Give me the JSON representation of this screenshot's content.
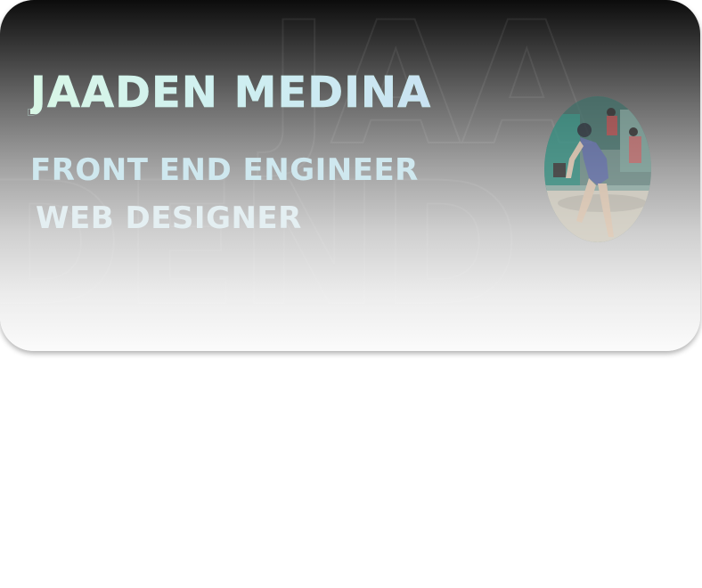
{
  "card": {
    "name": "JAADEN MEDINA",
    "roles": [
      "FRONT END ENGINEER",
      "WEB DESIGNER"
    ],
    "background_watermark": [
      "JAA",
      "DEND"
    ]
  },
  "photo": {
    "alt": "Wrestler in stance on mat"
  },
  "colors": {
    "card_top": "#0c0c0c",
    "card_bottom": "#fbfbfb",
    "name_start": "#d9f7e6",
    "name_end": "#c6dcf3",
    "role_text": "#dfeef3"
  }
}
